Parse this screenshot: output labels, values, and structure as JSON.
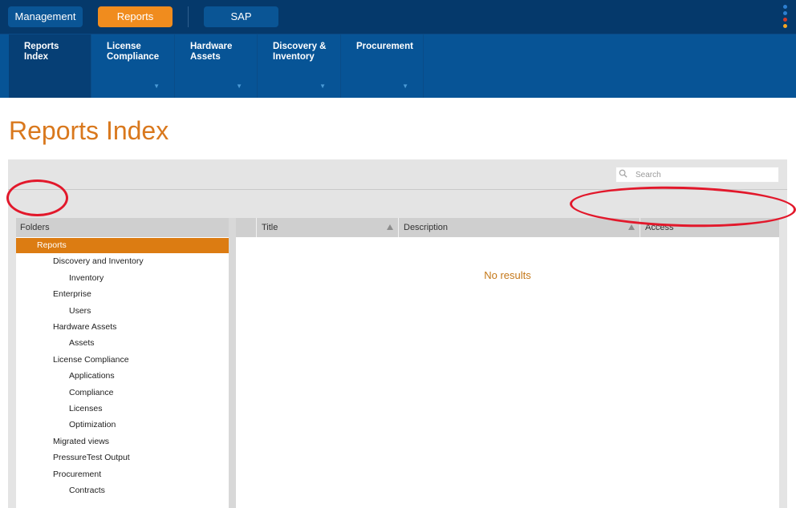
{
  "topbar": {
    "buttons": [
      {
        "label": "Management"
      },
      {
        "label": "Reports",
        "active": true
      },
      {
        "label": "SAP"
      }
    ],
    "menu_dot_colors": [
      "#2d7fd0",
      "#2d7fd0",
      "#d13b2a",
      "#f5a623"
    ]
  },
  "subnav": {
    "items": [
      {
        "line1": "Reports",
        "line2": "Index",
        "active": true
      },
      {
        "line1": "License",
        "line2": "Compliance",
        "has_dropdown": true
      },
      {
        "line1": "Hardware",
        "line2": "Assets",
        "has_dropdown": true
      },
      {
        "line1": "Discovery &",
        "line2": "Inventory",
        "has_dropdown": true
      },
      {
        "line1": "Procurement",
        "line2": "",
        "has_dropdown": true
      }
    ],
    "caret": "▼"
  },
  "page": {
    "title": "Reports Index"
  },
  "search": {
    "placeholder": "Search",
    "icon": "search-icon"
  },
  "folders": {
    "header": "Folders",
    "items": [
      {
        "label": "Reports",
        "level": 0,
        "selected": true
      },
      {
        "label": "Discovery and Inventory",
        "level": 1
      },
      {
        "label": "Inventory",
        "level": 2
      },
      {
        "label": "Enterprise",
        "level": 1
      },
      {
        "label": "Users",
        "level": 2
      },
      {
        "label": "Hardware Assets",
        "level": 1
      },
      {
        "label": "Assets",
        "level": 2
      },
      {
        "label": "License Compliance",
        "level": 1
      },
      {
        "label": "Applications",
        "level": 2
      },
      {
        "label": "Compliance",
        "level": 2
      },
      {
        "label": "Licenses",
        "level": 2
      },
      {
        "label": "Optimization",
        "level": 2
      },
      {
        "label": "Migrated views",
        "level": 1
      },
      {
        "label": "PressureTest Output",
        "level": 1
      },
      {
        "label": "Procurement",
        "level": 1
      },
      {
        "label": "Contracts",
        "level": 2
      }
    ]
  },
  "grid": {
    "columns": [
      "Title",
      "Description",
      "Access"
    ],
    "empty_text": "No results"
  },
  "colors": {
    "accent_orange": "#f08c1e",
    "nav_blue": "#075496",
    "top_blue": "#05396b",
    "annotation_red": "#e2182b"
  }
}
